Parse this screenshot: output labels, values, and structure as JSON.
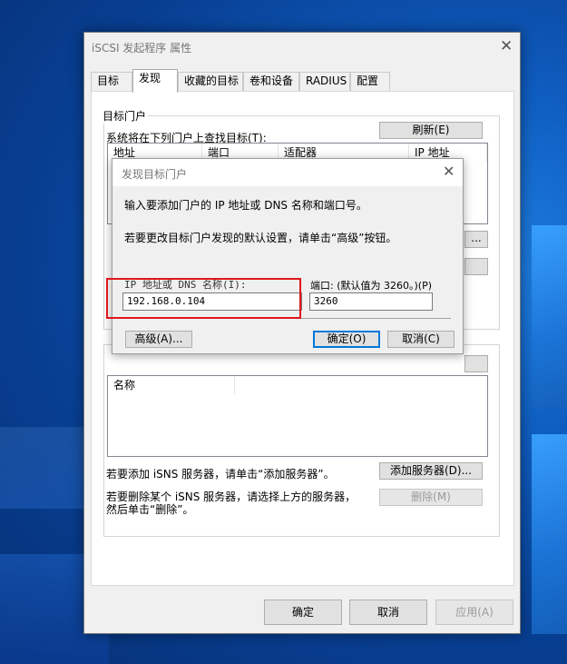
{
  "window": {
    "title": "iSCSI 发起程序 属性",
    "close_glyph": "✕"
  },
  "tabs": [
    {
      "label": "目标",
      "active": false
    },
    {
      "label": "发现",
      "active": true
    },
    {
      "label": "收藏的目标",
      "active": false
    },
    {
      "label": "卷和设备",
      "active": false
    },
    {
      "label": "RADIUS",
      "active": false
    },
    {
      "label": "配置",
      "active": false
    }
  ],
  "portal_group": {
    "label": "目标门户",
    "description": "系统将在下列门户上查找目标(T):",
    "refresh_button": "刷新(E)",
    "columns": [
      "地址",
      "端口",
      "适配器",
      "IP 地址"
    ],
    "hidden_button": "..."
  },
  "isns_group": {
    "column": "名称",
    "add_text": "若要添加 iSNS 服务器，请单击“添加服务器”。",
    "add_button": "添加服务器(D)...",
    "remove_text_line1": "若要删除某个 iSNS 服务器，请选择上方的服务器，",
    "remove_text_line2": "然后单击“删除”。",
    "remove_button": "删除(M)"
  },
  "footer": {
    "ok": "确定",
    "cancel": "取消",
    "apply": "应用(A)"
  },
  "dialog": {
    "title": "发现目标门户",
    "close_glyph": "✕",
    "intro": "输入要添加门户的 IP 地址或 DNS 名称和端口号。",
    "advanced_hint": "若要更改目标门户发现的默认设置，请单击“高级”按钮。",
    "ip_label": "IP 地址或 DNS 名称(I):",
    "ip_value": "192.168.0.104",
    "port_label": "端口: (默认值为 3260。)(P)",
    "port_value": "3260",
    "advanced_button": "高级(A)...",
    "ok_button": "确定(O)",
    "cancel_button": "取消(C)"
  },
  "colors": {
    "highlight": "#e0161c",
    "focus": "#0078d7",
    "desktop": "#0f5ec2"
  }
}
